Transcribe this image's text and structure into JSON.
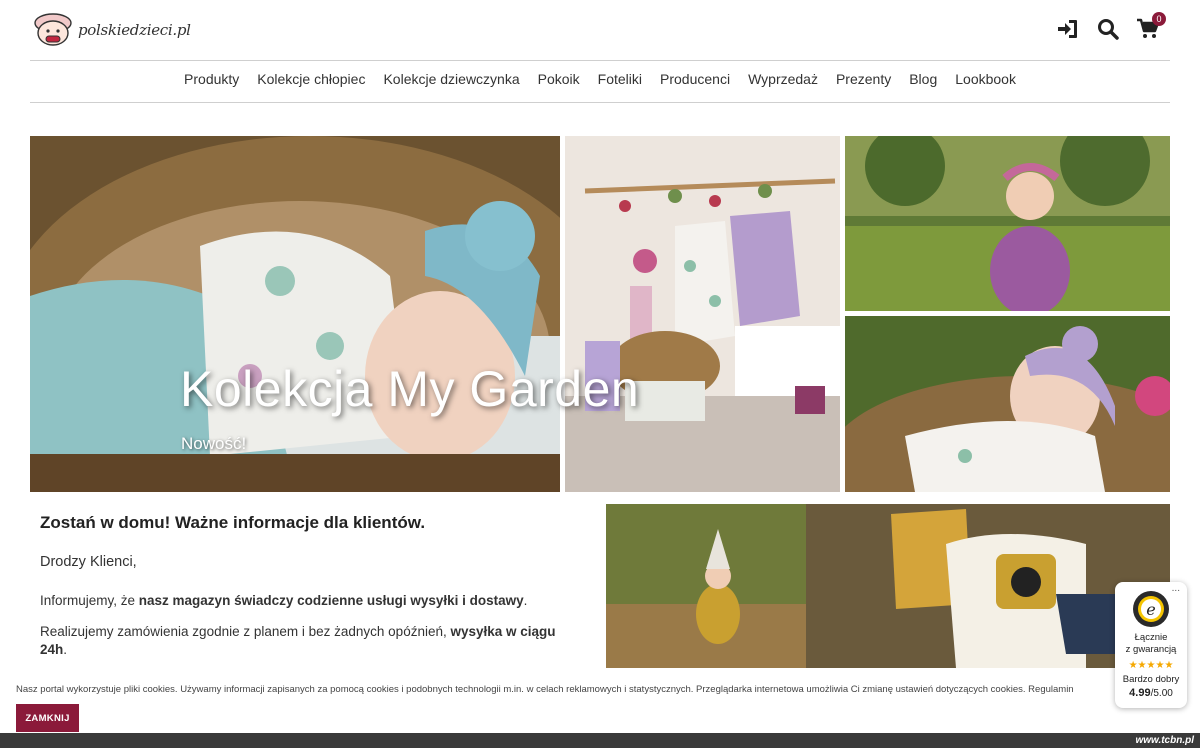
{
  "header": {
    "logo_text": "polskiedzieci.pl",
    "cart_count": "0"
  },
  "nav": [
    {
      "label": "Produkty"
    },
    {
      "label": "Kolekcje chłopiec"
    },
    {
      "label": "Kolekcje dziewczynka"
    },
    {
      "label": "Pokoik"
    },
    {
      "label": "Foteliki"
    },
    {
      "label": "Producenci"
    },
    {
      "label": "Wyprzedaż"
    },
    {
      "label": "Prezenty"
    },
    {
      "label": "Blog"
    },
    {
      "label": "Lookbook"
    }
  ],
  "hero": {
    "title": "Kolekcja My Garden",
    "subtitle": "Nowość!"
  },
  "info": {
    "heading": "Zostań w domu! Ważne informacje dla klientów.",
    "greeting": "Drodzy Klienci,",
    "p1_a": "Informujemy, że ",
    "p1_b": "nasz magazyn świadczy codzienne usługi wysyłki i dostawy",
    "p1_c": ".",
    "p2_a": "Realizujemy zamówienia zgodnie z planem i bez żadnych opóźnień, ",
    "p2_b": "wysyłka w ciągu 24h",
    "p2_c": "."
  },
  "cookie": {
    "text": "Nasz portal wykorzystuje pliki cookies. Używamy informacji zapisanych za pomocą cookies i podobnych technologii m.in. w celach reklamowych i statystycznych. Przeglądarka internetowa umożliwia Ci zmianę ustawień dotyczących cookies. Regulamin",
    "button": "ZAMKNIJ"
  },
  "trusted": {
    "dots": "...",
    "line1": "Łącznie",
    "line2": "z gwarancją",
    "stars": "★★★★★",
    "rating_word": "Bardzo dobry",
    "score": "4.99",
    "score_max": "/5.00"
  },
  "footer": {
    "watermark": "www.tcbn.pl"
  },
  "colors": {
    "brand": "#8b1a3a",
    "stars": "#f5a800"
  }
}
